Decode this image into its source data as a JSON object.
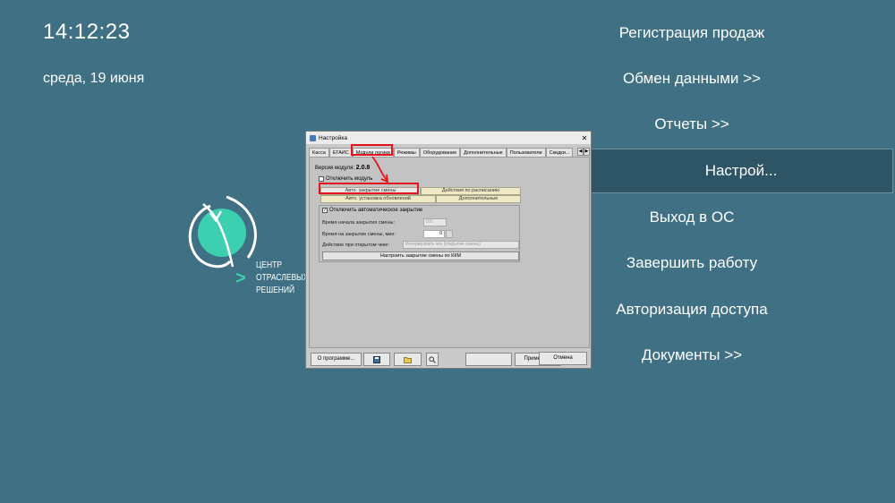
{
  "clock": {
    "time": "14:12:23",
    "date": "среда, 19 июня"
  },
  "menu": [
    {
      "label": "Регистрация продаж"
    },
    {
      "label": "Обмен данными >>"
    },
    {
      "label": "Отчеты >>"
    },
    {
      "label": "Настрой..."
    },
    {
      "label": "Выход в ОС"
    },
    {
      "label": "Завершить работу"
    },
    {
      "label": "Авторизация доступа"
    },
    {
      "label": "Документы >>"
    }
  ],
  "logo": {
    "line1": "ЦЕНТР",
    "line2": "ОТРАСЛЕВЫХ",
    "line3": "РЕШЕНИЙ",
    "arrow": ">"
  },
  "dialog": {
    "title": "Настройка",
    "close": "✕",
    "tabs": [
      "Касса",
      "ЕГАИС",
      "Модули логики",
      "Режимы",
      "Оборудование",
      "Дополнительные",
      "Пользователи",
      "Скидки..."
    ],
    "tab_prev": "◀",
    "tab_next": "▶",
    "version_label": "Версия модуля:",
    "version_value": "2.0.8",
    "disable_module": "Отключить модуль",
    "subtabs": {
      "auto_close": "Авто. закрытие смены",
      "schedule": "Действия по расписанию",
      "auto_update": "Авто. установка обновлений",
      "additional": "Дополнительные"
    },
    "disable_auto_close": "Отключить автоматическое закрытие",
    "start_time_label": "Время начала закрытия смены:",
    "start_time_value": "0:0",
    "close_minutes_label": "Время на закрытие смены, мин:",
    "close_minutes_value": "0",
    "open_check_label": "Действие при открытом чеке:",
    "open_check_value": "Игнорировать чек (открытие смены)",
    "configure_button": "Настроить закрытие смены по ККМ",
    "buttons": {
      "about": "О программе...",
      "ok": "OK",
      "apply": "Применить",
      "cancel": "Отмена"
    }
  },
  "colors": {
    "background": "#3f7083",
    "active_item": "#2e5566",
    "highlight": "#e5121b",
    "accent": "#3ccfb0"
  }
}
